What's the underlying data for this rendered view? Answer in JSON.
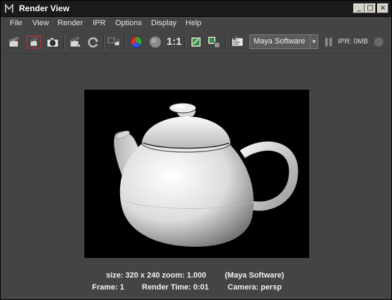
{
  "window": {
    "title": "Render View"
  },
  "window_controls": {
    "minimize": "_",
    "maximize": "□",
    "close": "×"
  },
  "menu": [
    "File",
    "View",
    "Render",
    "IPR",
    "Options",
    "Display",
    "Help"
  ],
  "toolbar": {
    "icons": [
      "clapper-icon",
      "redo-render-icon",
      "snapshot-camera-icon",
      "ipr-clapper-icon",
      "refresh-icon",
      "render-region-icon",
      "rgb-channels-icon",
      "alpha-channel-icon",
      "real-size-icon",
      "keep-image-icon",
      "remove-image-icon",
      "render-settings-icon"
    ],
    "real_size_label": "1:1",
    "renderer": "Maya Software",
    "ipr_memory": "IPR: 0MB"
  },
  "render_info": {
    "line1_left": "size: 320 x 240 zoom: 1.000",
    "line1_right": "(Maya Software)",
    "frame": "Frame: 1",
    "render_time": "Render Time: 0:01",
    "camera": "Camera: persp"
  }
}
